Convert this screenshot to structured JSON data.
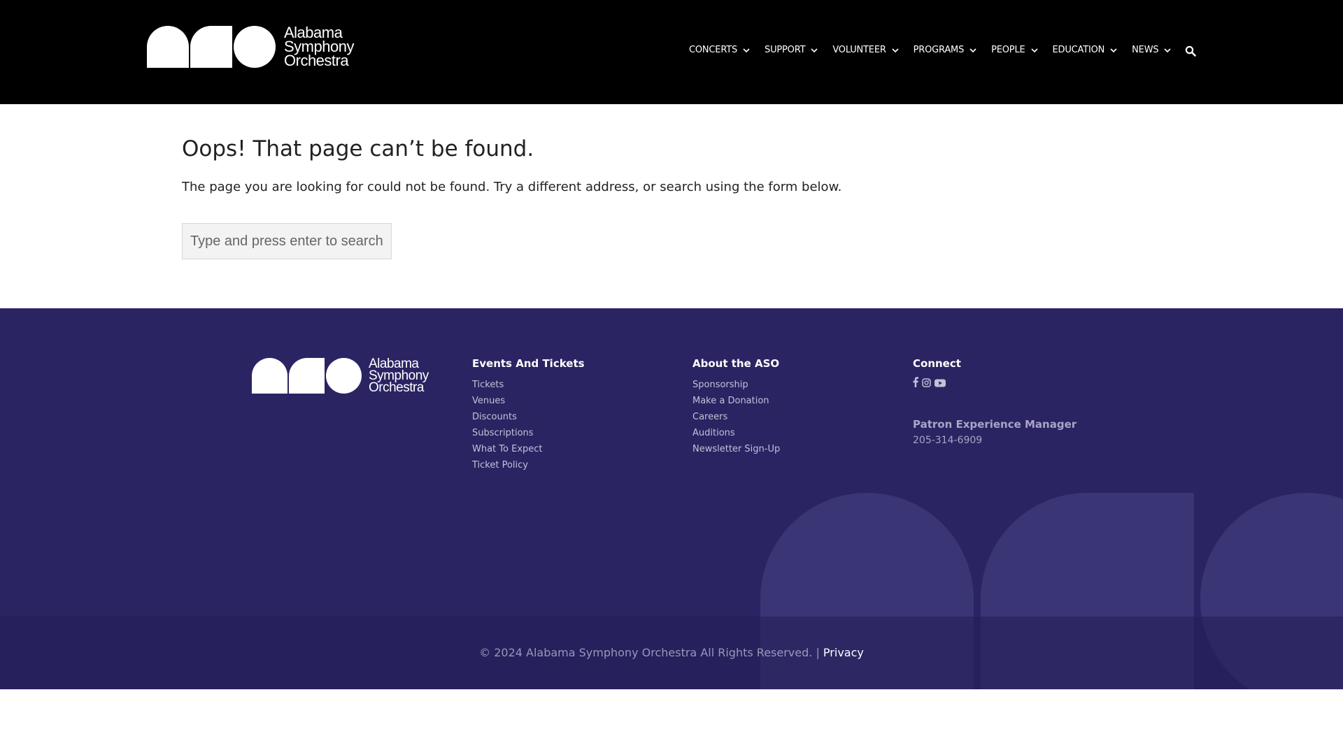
{
  "header": {
    "logo": {
      "line1": "Alabama",
      "line2": "Symphony",
      "line3": "Orchestra"
    },
    "nav": [
      {
        "label": "CONCERTS"
      },
      {
        "label": "SUPPORT"
      },
      {
        "label": "VOLUNTEER"
      },
      {
        "label": "PROGRAMS"
      },
      {
        "label": "PEOPLE"
      },
      {
        "label": "EDUCATION"
      },
      {
        "label": "NEWS"
      }
    ],
    "search_icon": "search-icon"
  },
  "main": {
    "title": "Oops! That page can’t be found.",
    "description": "The page you are looking for could not be found. Try a different address, or search using the form below.",
    "search_placeholder": "Type and press enter to search"
  },
  "footer": {
    "logo": {
      "line1": "Alabama",
      "line2": "Symphony",
      "line3": "Orchestra"
    },
    "events": {
      "heading": "Events And Tickets",
      "links": [
        "Tickets",
        "Venues",
        "Discounts",
        "Subscriptions",
        "What To Expect",
        "Ticket Policy"
      ]
    },
    "about": {
      "heading": "About the ASO",
      "links": [
        "Sponsorship",
        "Make a Donation",
        "Careers",
        "Auditions",
        "Newsletter Sign-Up"
      ]
    },
    "connect": {
      "heading": "Connect",
      "social_icons": [
        "facebook-icon",
        "instagram-icon",
        "youtube-icon"
      ],
      "contact_title": "Patron Experience Manager",
      "contact_phone": "205-314-6909"
    },
    "copyright": "© 2024 Alabama Symphony Orchestra All Rights Reserved. |",
    "privacy_label": "Privacy"
  },
  "colors": {
    "header_bg": "#000000",
    "footer_bg": "#2a2462",
    "footer_deco": "#3a3574"
  }
}
